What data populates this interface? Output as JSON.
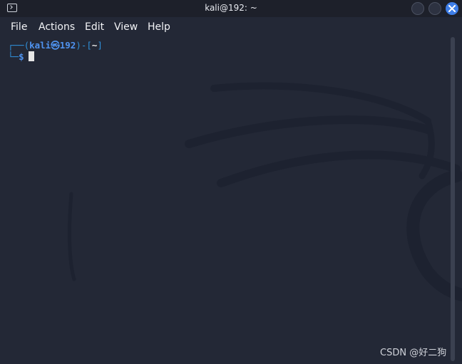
{
  "window": {
    "title": "kali@192: ~"
  },
  "menu": {
    "file": "File",
    "actions": "Actions",
    "edit": "Edit",
    "view": "View",
    "help": "Help"
  },
  "terminal": {
    "prompt_top_frame": "┌──(",
    "user": "kali",
    "separator": "㉿",
    "host": "192",
    "bracket_mid": ")-[",
    "cwd": "~",
    "bracket_end": "]",
    "prompt_bottom_frame": "└─",
    "dollar": "$",
    "input": ""
  },
  "watermark": "CSDN @好二狗",
  "icons": {
    "app": "terminal-icon",
    "minimize": "minimize-icon",
    "maximize": "maximize-icon",
    "close": "close-icon"
  },
  "colors": {
    "background": "#232836",
    "titlebar": "#1d202a",
    "prompt_blue": "#4f93f0",
    "close_button": "#3e7ee8"
  }
}
